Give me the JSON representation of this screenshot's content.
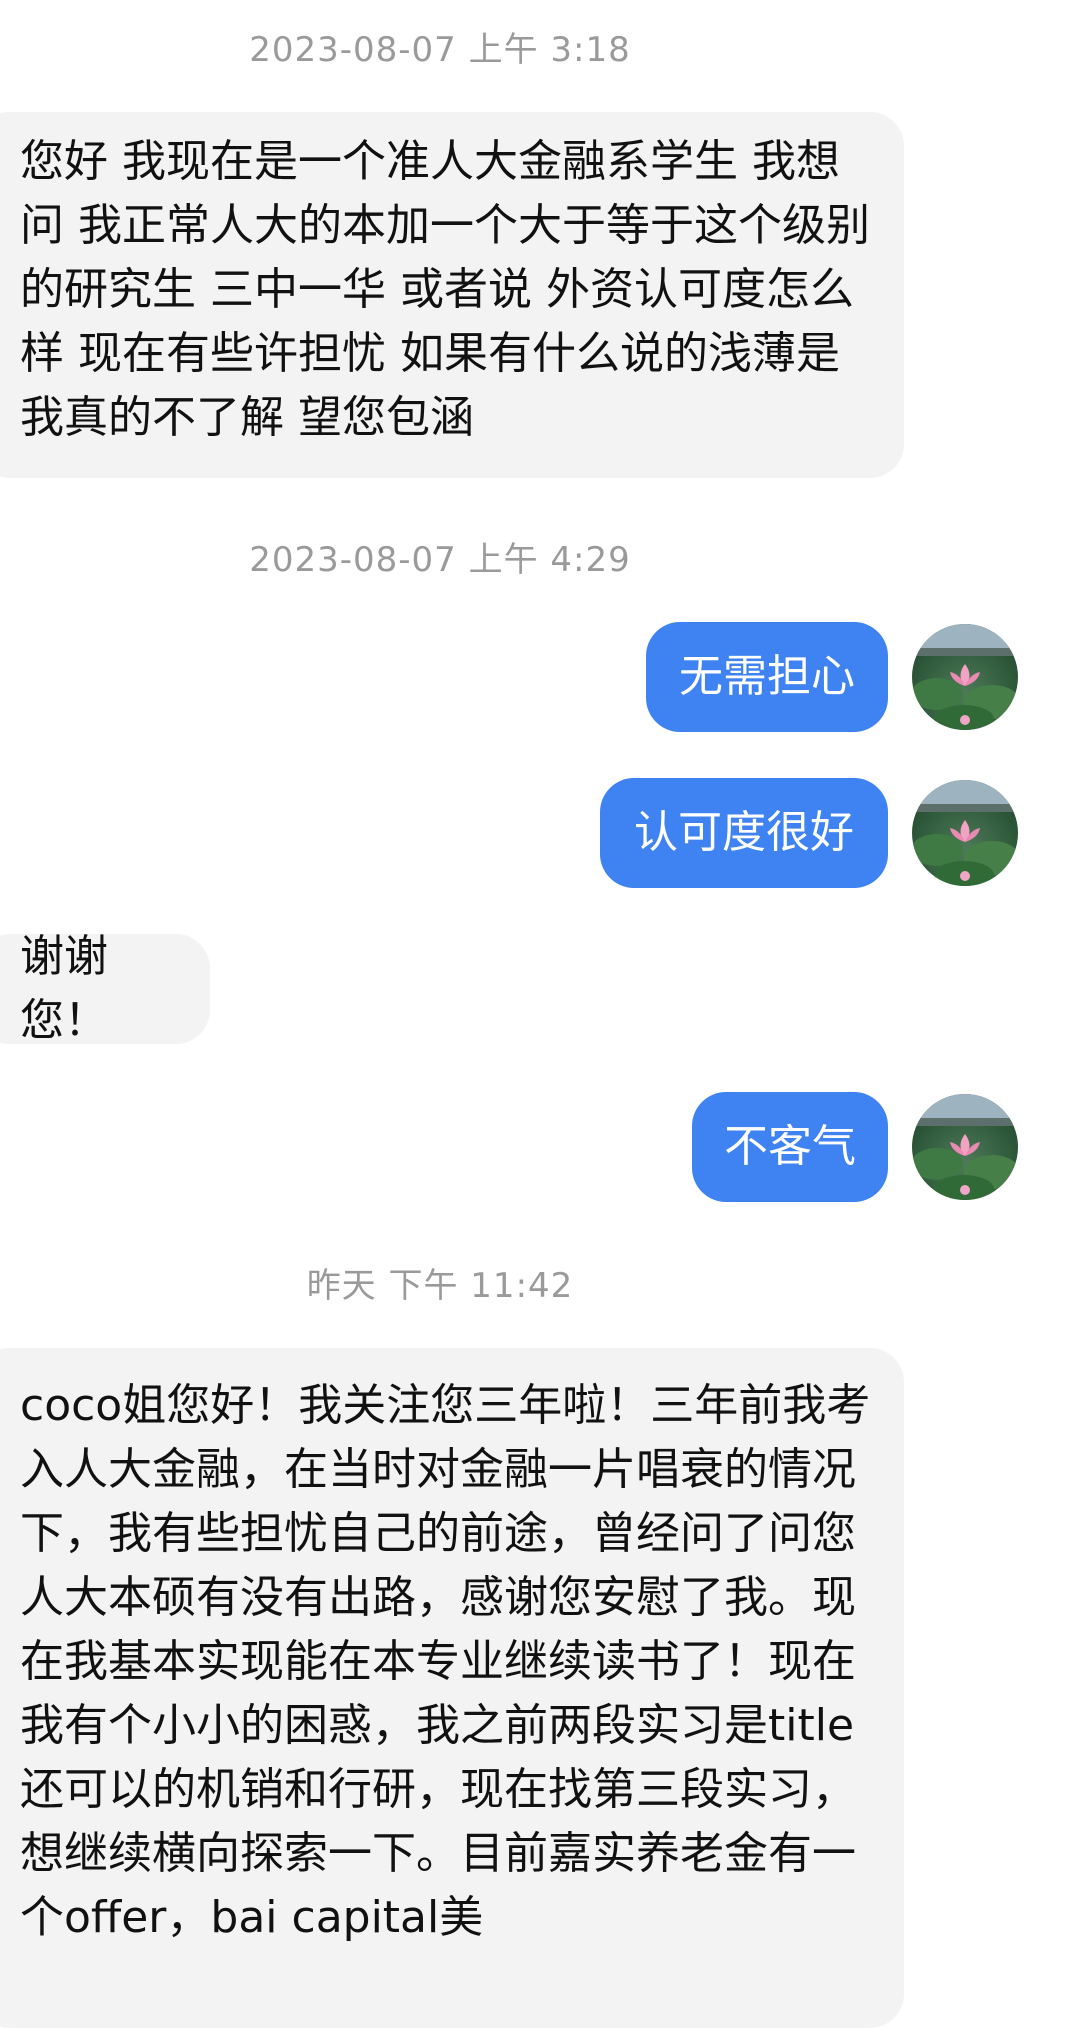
{
  "timestamps": {
    "t1": "2023-08-07 上午 3:18",
    "t2": "2023-08-07 上午 4:29",
    "t3": "昨天 下午 11:42"
  },
  "messages": {
    "m1": "您好 我现在是一个准人大金融系学生 我想问 我正常人大的本加一个大于等于这个级别的研究生 三中一华 或者说 外资认可度怎么样 现在有些许担忧 如果有什么说的浅薄是我真的不了解 望您包涵",
    "m2": "无需担心",
    "m3": "认可度很好",
    "m4": "谢谢您！",
    "m5": "不客气",
    "m6": "coco姐您好！我关注您三年啦！三年前我考入人大金融，在当时对金融一片唱衰的情况下，我有些担忧自己的前途，曾经问了问您人大本硕有没有出路，感谢您安慰了我。现在我基本实现能在本专业继续读书了！现在我有个小小的困惑，我之前两段实习是title还可以的机销和行研，现在找第三段实习，想继续横向探索一下。目前嘉实养老金有一个offer，bai capital美"
  },
  "avatar_icon": "lotus-avatar-icon"
}
